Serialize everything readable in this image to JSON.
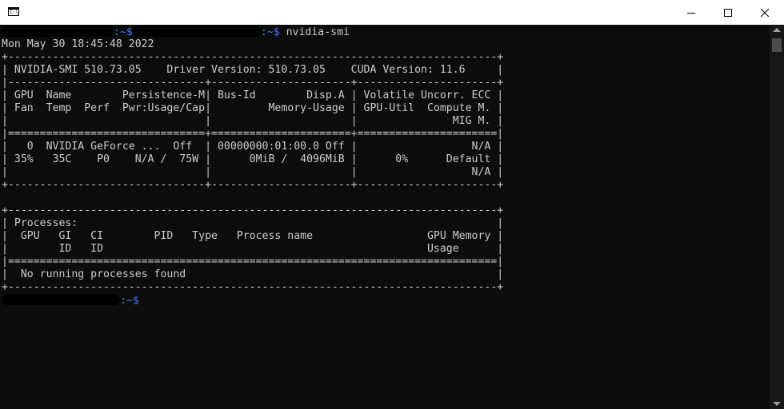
{
  "window": {
    "icon_text": "C:\\",
    "icon": "console-app-icon",
    "buttons": {
      "minimize": "minimize-icon",
      "maximize": "maximize-icon",
      "close": "close-icon"
    }
  },
  "terminal": {
    "prompt_suffix": ":~$",
    "command": " nvidia-smi",
    "path_color": "#3b78ff",
    "text_color": "#cccccc",
    "background": "#0c0c0c",
    "lines": [
      "Mon May 30 18:45:48 2022",
      "+-----------------------------------------------------------------------------+",
      "| NVIDIA-SMI 510.73.05    Driver Version: 510.73.05    CUDA Version: 11.6     |",
      "|-------------------------------+----------------------+----------------------+",
      "| GPU  Name        Persistence-M| Bus-Id        Disp.A | Volatile Uncorr. ECC |",
      "| Fan  Temp  Perf  Pwr:Usage/Cap|         Memory-Usage | GPU-Util  Compute M. |",
      "|                               |                      |               MIG M. |",
      "|===============================+======================+======================|",
      "|   0  NVIDIA GeForce ...  Off  | 00000000:01:00.0 Off |                  N/A |",
      "| 35%   35C    P0    N/A /  75W |      0MiB /  4096MiB |      0%      Default |",
      "|                               |                      |                  N/A |",
      "+-------------------------------+----------------------+----------------------+",
      "",
      "+-----------------------------------------------------------------------------+",
      "| Processes:                                                                  |",
      "|  GPU   GI   CI        PID   Type   Process name                  GPU Memory |",
      "|        ID   ID                                                   Usage      |",
      "|=============================================================================|",
      "|  No running processes found                                                 |",
      "+-----------------------------------------------------------------------------+"
    ]
  },
  "scrollbar": {
    "up_icon": "scroll-up-arrow-icon",
    "down_icon": "scroll-down-arrow-icon",
    "position": 0.0
  }
}
